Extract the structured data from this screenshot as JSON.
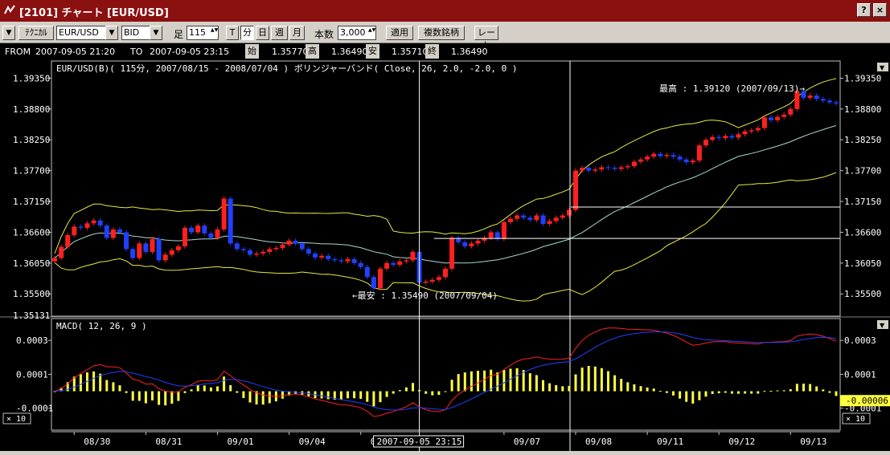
{
  "window": {
    "title": "[2101] チャート [EUR/USD]",
    "help_btn": "?",
    "close_btn": "×"
  },
  "toolbar": {
    "menu_arrow": "▼",
    "technical": "ﾃｸﾆｶﾙ",
    "symbol": "EUR/USD",
    "side": "BID",
    "ashi_label": "足",
    "period_value": "115",
    "btn_t": "T",
    "btn_min": "分",
    "btn_day": "日",
    "btn_week": "週",
    "btn_month": "月",
    "count_label": "本数",
    "count_value": "3,000",
    "apply": "適用",
    "multi": "複数銘柄",
    "rate": "レート",
    "spin_glyph": "▲▼"
  },
  "infobar": {
    "from_label": "FROM",
    "from_value": "2007-09-05  21:20",
    "to_label": "TO",
    "to_value": "2007-09-05  23:15",
    "open_label": "始",
    "open_value": "1.35770",
    "high_label": "高",
    "high_value": "1.36490",
    "low_label": "安",
    "low_value": "1.35710",
    "close_label": "終",
    "close_value": "1.36490"
  },
  "chart_data": [
    {
      "type": "candlestick",
      "title": "EUR/USD(B)( 115分, 2007/08/15 - 2008/07/04 )   ボリンジャーバンド( Close, 26, 2.0, -2.0, 0 )",
      "ylim": [
        1.35131,
        1.396
      ],
      "yticks": [
        "1.39350",
        "1.38800",
        "1.38250",
        "1.37700",
        "1.37150",
        "1.36600",
        "1.36050",
        "1.35500"
      ],
      "yticks_num": [
        1.3935,
        1.388,
        1.3825,
        1.377,
        1.3715,
        1.366,
        1.3605,
        1.355
      ],
      "bottom_tick_partial": "1.35131",
      "xticks": [
        "08/30",
        "08/31",
        "09/01",
        "09/04",
        "09/05",
        "09/07",
        "09/08",
        "09/11",
        "09/12",
        "09/13"
      ],
      "xtick_index": [
        3,
        14,
        25,
        36,
        47,
        69,
        80,
        91,
        102,
        113
      ],
      "cursor_label": "2007-09-05  23:15",
      "cursor_index": 56,
      "crosshair_price": 1.3649,
      "crosshair_price2": 1.3705,
      "annotations": {
        "high": "最高 : 1.39120 (2007/09/13)→",
        "low": "←最安 : 1.35490 (2007/09/04)",
        "high_index": 112,
        "low_index": 45
      },
      "colors": {
        "up": "#ff2020",
        "down": "#2040ff",
        "band": "#e8e840",
        "mid": "#a8d8d0",
        "cross": "#ffffff"
      },
      "closes": [
        1.3614,
        1.3634,
        1.3655,
        1.367,
        1.3668,
        1.3676,
        1.3681,
        1.3672,
        1.365,
        1.3665,
        1.366,
        1.363,
        1.3614,
        1.364,
        1.3625,
        1.3648,
        1.361,
        1.362,
        1.3628,
        1.3635,
        1.3668,
        1.366,
        1.3672,
        1.3658,
        1.365,
        1.3665,
        1.372,
        1.364,
        1.363,
        1.3628,
        1.362,
        1.3622,
        1.3625,
        1.363,
        1.3632,
        1.3638,
        1.3645,
        1.364,
        1.363,
        1.3622,
        1.3615,
        1.3618,
        1.3612,
        1.361,
        1.3608,
        1.3612,
        1.3605,
        1.3598,
        1.358,
        1.356,
        1.3595,
        1.3605,
        1.3602,
        1.3608,
        1.361,
        1.3625,
        1.357,
        1.3572,
        1.3575,
        1.358,
        1.3595,
        1.365,
        1.3642,
        1.3635,
        1.364,
        1.3645,
        1.365,
        1.366,
        1.3648,
        1.3678,
        1.3684,
        1.369,
        1.3686,
        1.3682,
        1.369,
        1.3675,
        1.368,
        1.3686,
        1.369,
        1.37,
        1.377,
        1.3775,
        1.377,
        1.3772,
        1.3776,
        1.3775,
        1.3773,
        1.3776,
        1.3778,
        1.3786,
        1.379,
        1.3795,
        1.38,
        1.3796,
        1.3798,
        1.3795,
        1.379,
        1.3785,
        1.3788,
        1.3815,
        1.3825,
        1.383,
        1.3828,
        1.3832,
        1.3829,
        1.3835,
        1.384,
        1.3842,
        1.3846,
        1.3865,
        1.386,
        1.3866,
        1.387,
        1.388,
        1.3912,
        1.39,
        1.3904,
        1.3898,
        1.3895,
        1.3892,
        1.389
      ],
      "macd_title": "MACD( 12, 26, 9 )",
      "macd_yticks": [
        "0.0003",
        "0.0001",
        "-0.0001"
      ],
      "macd_yticks_num": [
        0.0003,
        0.0001,
        -0.0001
      ],
      "macd_ylim": [
        -0.00022,
        0.00041
      ],
      "macd_current": "-0.00006",
      "macd_colors": {
        "macd": "#ff2020",
        "signal": "#2040ff",
        "hist": "#ffff40"
      },
      "zoom_label": "× 10"
    }
  ]
}
